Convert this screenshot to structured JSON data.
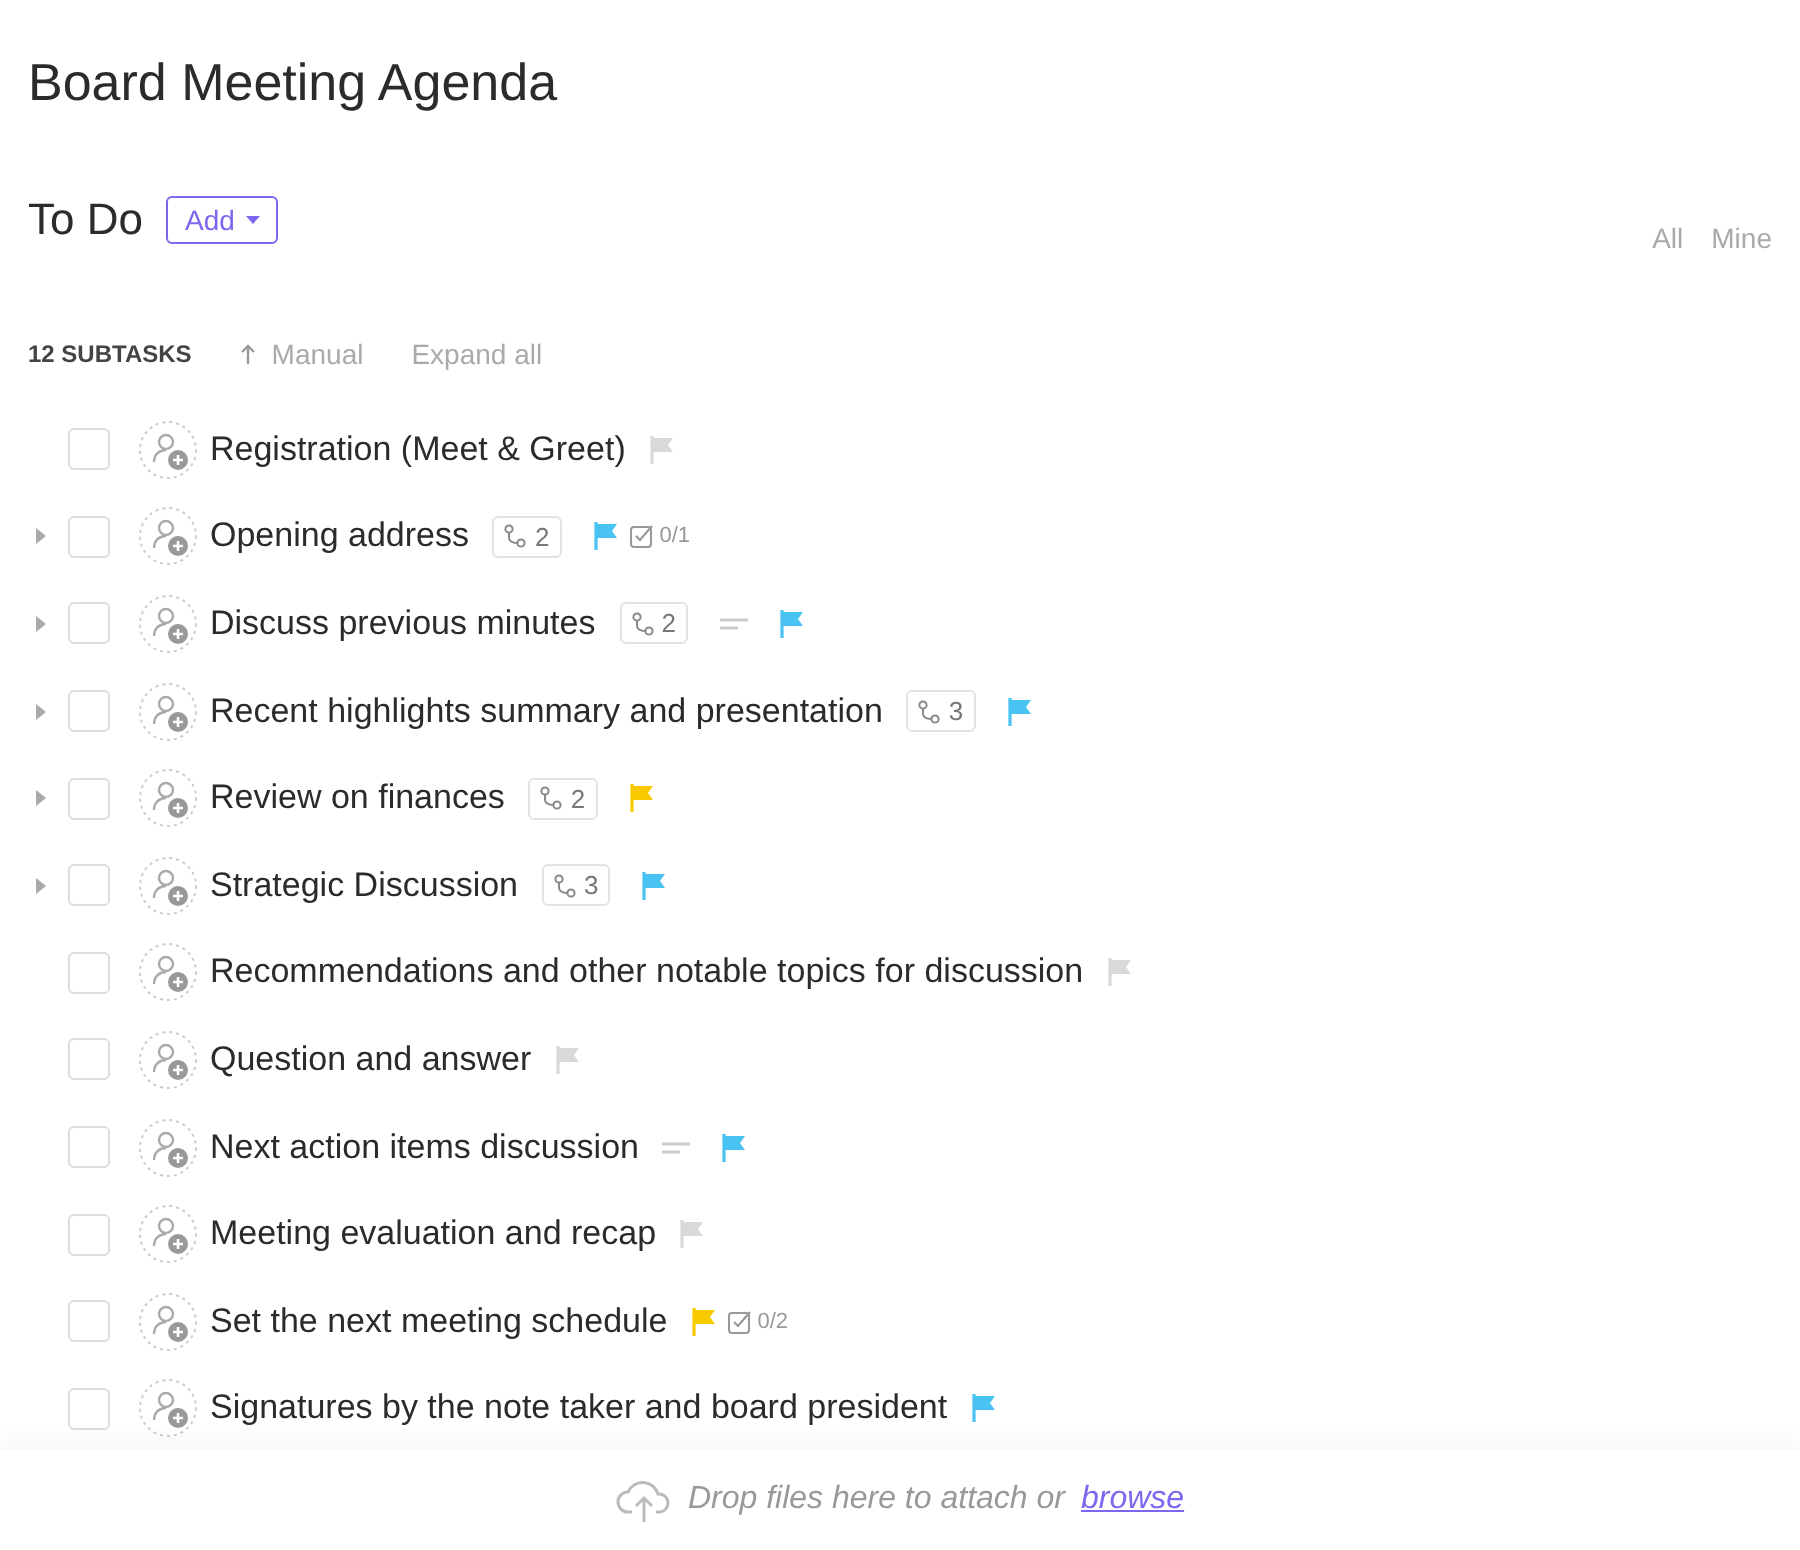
{
  "title": "Board Meeting Agenda",
  "status": {
    "label": "To Do",
    "add_button": "Add"
  },
  "filters": [
    {
      "label": "All",
      "selected": false
    },
    {
      "label": "Mine",
      "selected": false
    }
  ],
  "toolbar": {
    "count": "12 SUBTASKS",
    "sort": "Manual",
    "expand": "Expand all"
  },
  "subtasks": [
    {
      "name": "Registration (Meet & Greet)",
      "checked": false,
      "expandable": false,
      "color": "#d9d9d9"
    },
    {
      "name": "Opening address",
      "checked": false,
      "expandable": true,
      "subtasks": "2",
      "color": "#49c4f2",
      "checklist": "0/1"
    },
    {
      "name": "Discuss previous minutes",
      "checked": false,
      "expandable": true,
      "subtasks": "2",
      "description": true,
      "color": "#49c4f2"
    },
    {
      "name": "Recent highlights summary and presentation",
      "checked": false,
      "expandable": true,
      "subtasks": "3",
      "color": "#49c4f2"
    },
    {
      "name": "Review on finances",
      "checked": false,
      "expandable": true,
      "subtasks": "2",
      "color": "#f9c900"
    },
    {
      "name": "Strategic Discussion",
      "checked": false,
      "expandable": true,
      "subtasks": "3",
      "color": "#49c4f2"
    },
    {
      "name": "Recommendations and other notable topics for discussion",
      "checked": false,
      "expandable": false,
      "color": "#d9d9d9"
    },
    {
      "name": "Question and answer",
      "checked": false,
      "expandable": false,
      "color": "#d9d9d9"
    },
    {
      "name": "Next action items discussion",
      "checked": false,
      "expandable": false,
      "description": true,
      "color": "#49c4f2"
    },
    {
      "name": "Meeting evaluation and recap",
      "checked": false,
      "expandable": false,
      "color": "#d9d9d9"
    },
    {
      "name": "Set the next meeting schedule",
      "checked": false,
      "expandable": false,
      "color": "#f9c900",
      "checklist": "0/2"
    },
    {
      "name": "Signatures by the note taker and board president",
      "checked": false,
      "expandable": false,
      "color": "#49c4f2"
    }
  ],
  "footer": {
    "text": "Drop files here to attach or",
    "link": "browse"
  }
}
